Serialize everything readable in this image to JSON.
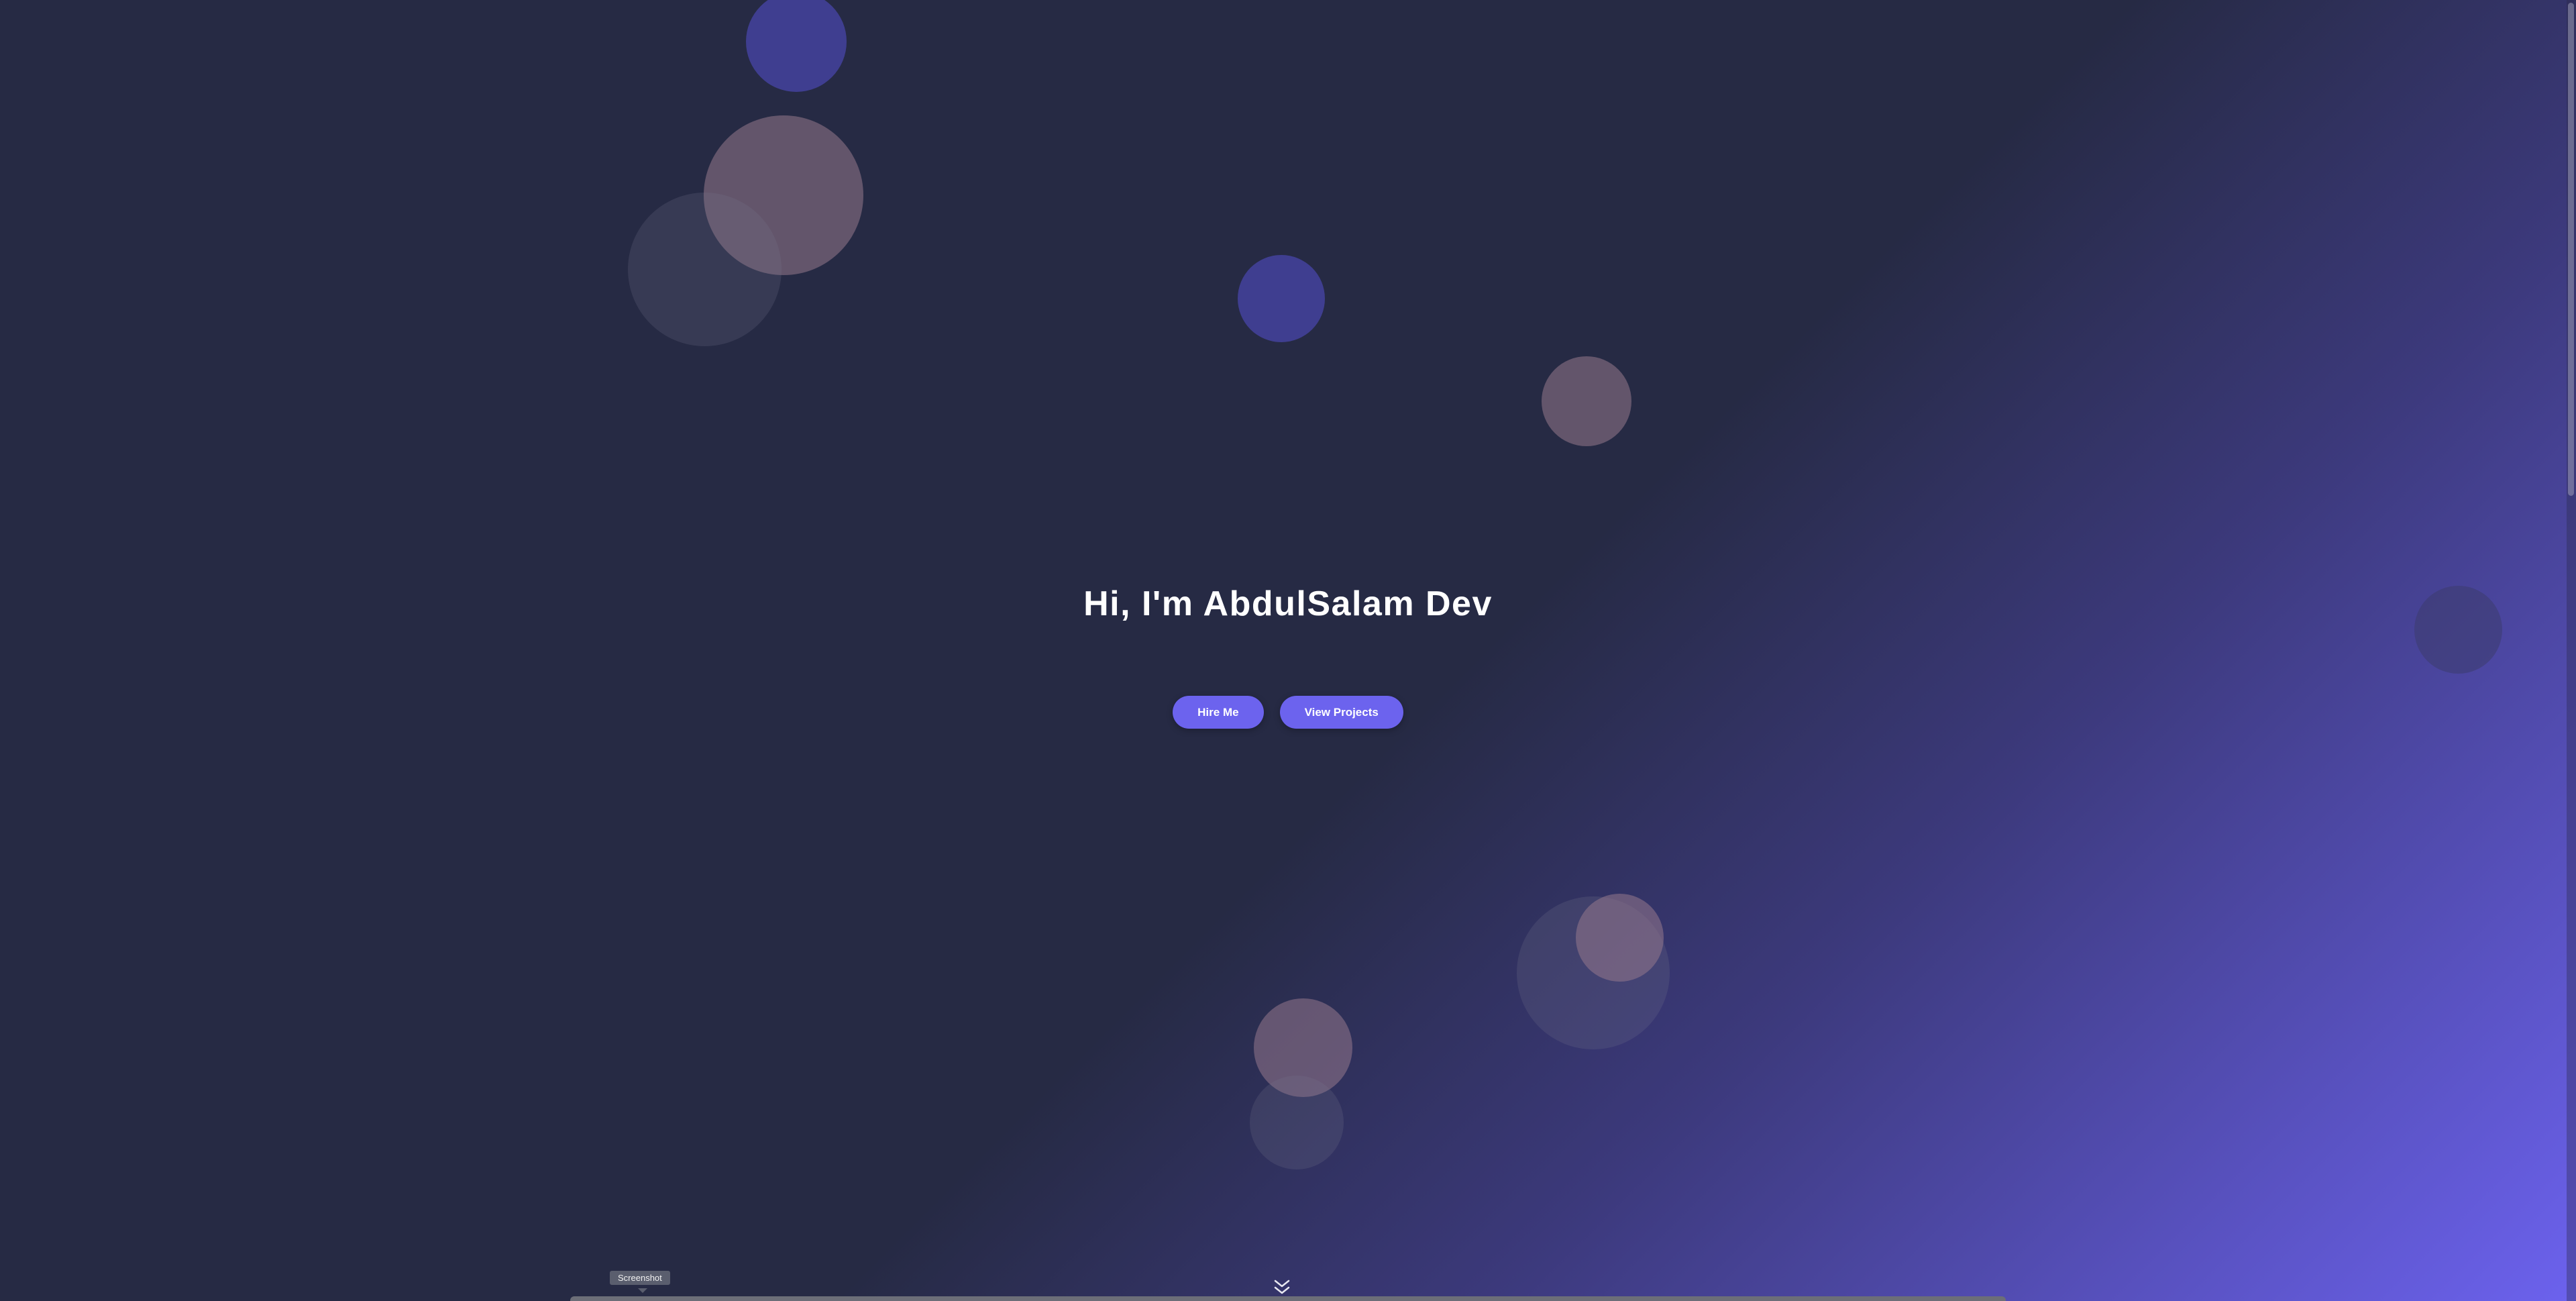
{
  "hero": {
    "headline": "Hi, I'm AbdulSalam Dev",
    "buttons": {
      "hire_label": "Hire Me",
      "projects_label": "View Projects"
    }
  },
  "tooltip": {
    "label": "Screenshot"
  },
  "icons": {
    "scroll_indicator": "double-chevron-down-icon"
  },
  "colors": {
    "background": "#262a44",
    "accent": "#6c63ee",
    "headline_text": "#ffffff"
  }
}
